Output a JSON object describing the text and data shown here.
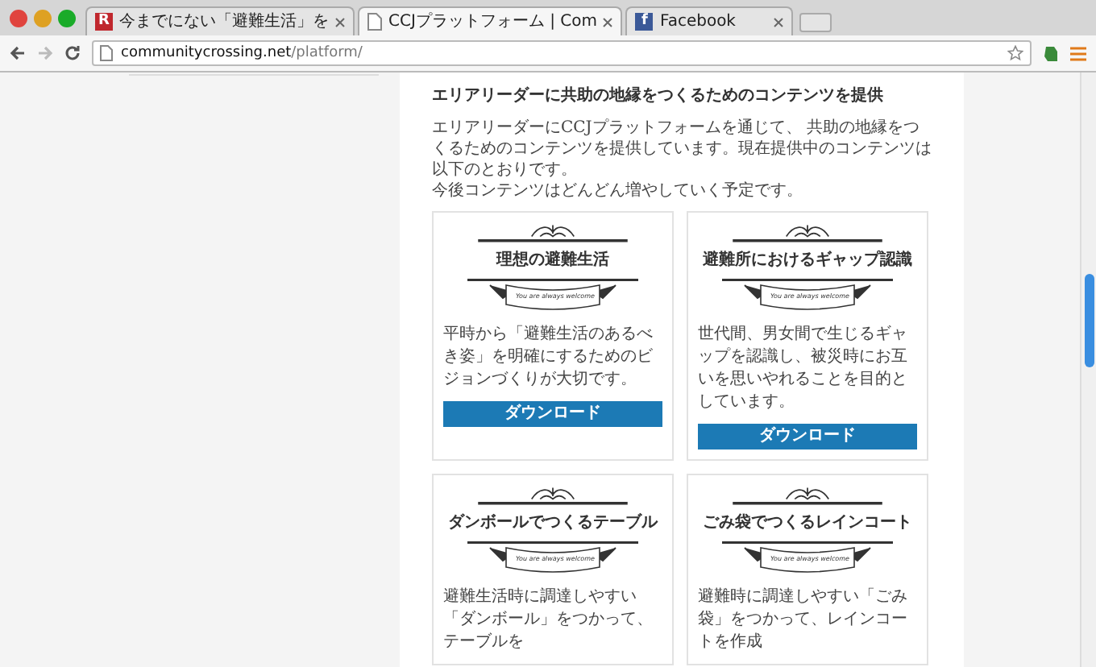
{
  "browser": {
    "tabs": [
      {
        "title": "今までにない「避難生活」を",
        "kind": "letter",
        "favicon_text": "R",
        "selected": false
      },
      {
        "title": "CCJプラットフォーム | Com",
        "kind": "page",
        "selected": true
      },
      {
        "title": "Facebook",
        "kind": "letter",
        "favicon_text": "f",
        "selected": false
      }
    ],
    "url_domain": "communitycrossing.net",
    "url_path": "/platform/"
  },
  "section": {
    "heading": "エリアリーダーに共助の地縁をつくるためのコンテンツを提供",
    "intro": [
      "エリアリーダーにCCJプラットフォームを通じて、 共助の地縁をつくるためのコンテンツを提供しています。現在提供中のコンテンツは以下のとおりです。",
      "今後コンテンツはどんどん増やしていく予定です。"
    ],
    "cards": [
      {
        "title": "理想の避難生活",
        "ribbon": "You are always welcome",
        "description": "平時から「避難生活のあるべき姿」を明確にするためのビジョンづくりが大切です。",
        "button": "ダウンロード"
      },
      {
        "title": "避難所におけるギャップ認識",
        "ribbon": "You are always welcome",
        "description": "世代間、男女間で生じるギャップを認識し、被災時にお互いを思いやれることを目的としています。",
        "button": "ダウンロード"
      },
      {
        "title": "ダンボールでつくるテーブル",
        "ribbon": "You are always welcome",
        "description": "避難生活時に調達しやすい「ダンボール」をつかって、テーブルを"
      },
      {
        "title": "ごみ袋でつくるレインコート",
        "ribbon": "You are always welcome",
        "description": "避難時に調達しやすい「ごみ袋」をつかって、レインコートを作成"
      }
    ]
  }
}
